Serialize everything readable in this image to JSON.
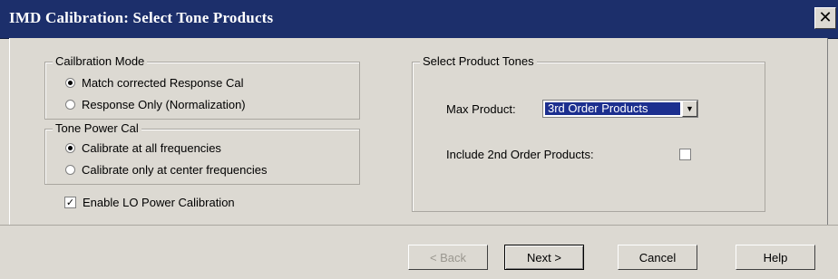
{
  "window": {
    "title": "IMD Calibration: Select Tone Products",
    "close_glyph": "✕"
  },
  "calibration_mode": {
    "legend": "Cailbration Mode",
    "options": [
      {
        "label": "Match corrected Response Cal",
        "selected": true
      },
      {
        "label": "Response Only (Normalization)",
        "selected": false
      }
    ]
  },
  "tone_power_cal": {
    "legend": "Tone Power Cal",
    "options": [
      {
        "label": "Calibrate at all frequencies",
        "selected": true
      },
      {
        "label": "Calibrate only at center frequencies",
        "selected": false
      }
    ]
  },
  "lo_power": {
    "label": "Enable LO Power Calibration",
    "checked": true,
    "check_glyph": "✓"
  },
  "product_tones": {
    "legend": "Select Product Tones",
    "max_product_label": "Max Product:",
    "max_product_value": "3rd Order Products",
    "arrow_glyph": "▼",
    "include_2nd_label": "Include 2nd Order Products:",
    "include_2nd_checked": false
  },
  "buttons": {
    "back": "< Back",
    "next": "Next >",
    "cancel": "Cancel",
    "help": "Help"
  },
  "colors": {
    "title_bar": "#1c2f6b",
    "dialog_bg": "#dcd9d2",
    "selection": "#1c2f8f"
  }
}
